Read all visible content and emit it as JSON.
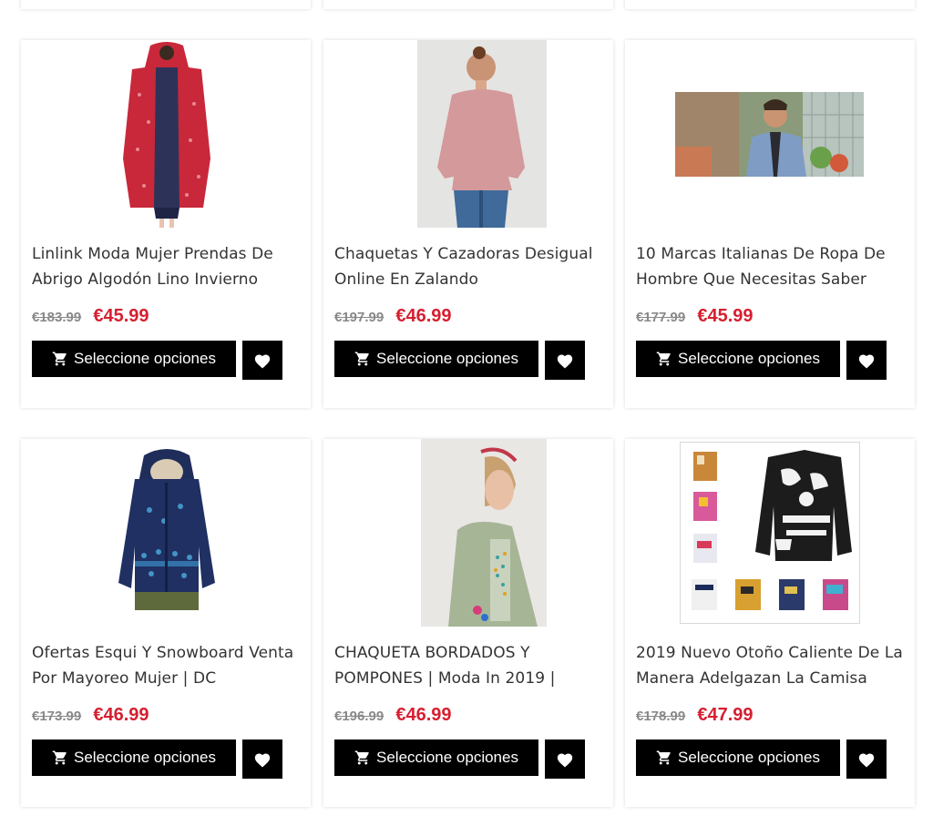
{
  "products": [
    {
      "title": "Linlink Moda Mujer Prendas De Abrigo Algodón Lino Invierno",
      "old_price": "€183.99",
      "new_price": "€45.99",
      "option_label": "Seleccione opciones",
      "image_alt": "red-floral-long-coat"
    },
    {
      "title": "Chaquetas Y Cazadoras Desigual Online En Zalando",
      "old_price": "€197.99",
      "new_price": "€46.99",
      "option_label": "Seleccione opciones",
      "image_alt": "pink-leather-jacket"
    },
    {
      "title": "10 Marcas Italianas De Ropa De Hombre Que Necesitas Saber",
      "old_price": "€177.99",
      "new_price": "€45.99",
      "option_label": "Seleccione opciones",
      "image_alt": "man-blue-blazer"
    },
    {
      "title": "Ofertas Esqui Y Snowboard Venta Por Mayoreo Mujer | DC",
      "old_price": "€173.99",
      "new_price": "€46.99",
      "option_label": "Seleccione opciones",
      "image_alt": "navy-snow-jacket"
    },
    {
      "title": "CHAQUETA BORDADOS Y POMPONES | Moda In 2019 |",
      "old_price": "€196.99",
      "new_price": "€46.99",
      "option_label": "Seleccione opciones",
      "image_alt": "green-embroidered-jacket"
    },
    {
      "title": "2019 Nuevo Otoño Caliente De La Manera Adelgazan La Camisa",
      "old_price": "€178.99",
      "new_price": "€47.99",
      "option_label": "Seleccione opciones",
      "image_alt": "printed-shirts-collage"
    }
  ],
  "colors": {
    "sale_price": "#d61f30",
    "old_price": "#888888",
    "button_bg": "#000000",
    "button_text": "#ffffff"
  },
  "icons": {
    "cart": "cart-icon",
    "wishlist": "heart-icon"
  }
}
